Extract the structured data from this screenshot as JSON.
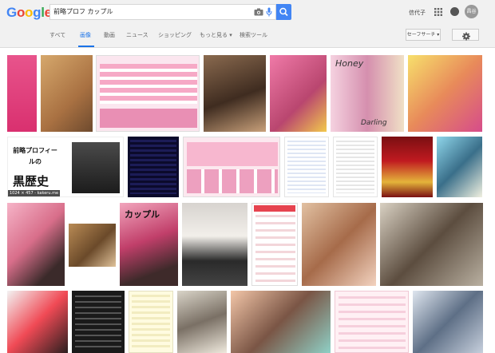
{
  "header": {
    "logo_letters": [
      "G",
      "o",
      "o",
      "g",
      "l",
      "e"
    ],
    "logo_colors": [
      "#4285f4",
      "#ea4335",
      "#fbbc05",
      "#4285f4",
      "#34a853",
      "#ea4335"
    ],
    "search_query": "前略プロフ カップル",
    "user_name": "信代子",
    "avatar_text": "昌谷"
  },
  "tabs": [
    {
      "label": "すべて",
      "active": false
    },
    {
      "label": "画像",
      "active": true
    },
    {
      "label": "動画",
      "active": false
    },
    {
      "label": "ニュース",
      "active": false
    },
    {
      "label": "ショッピング",
      "active": false
    },
    {
      "label": "もっと見る ▾",
      "active": false
    },
    {
      "label": "検索ツール",
      "active": false
    }
  ],
  "toolbar": {
    "safe_search_label": "セーフサーチ ▾"
  },
  "results": {
    "thumb_captions": {
      "kakeru": "1024 × 457 - kakeru.me"
    },
    "big_texts": {
      "profile_title": "前略プロフィールの",
      "kuro": "黒歴史",
      "honey": "Honey",
      "darling": "Darling",
      "couple": "カップル"
    }
  },
  "colors": {
    "accent": "#1a73e8",
    "search_button": "#4285f4",
    "purikura_pink": "#e8548c"
  }
}
